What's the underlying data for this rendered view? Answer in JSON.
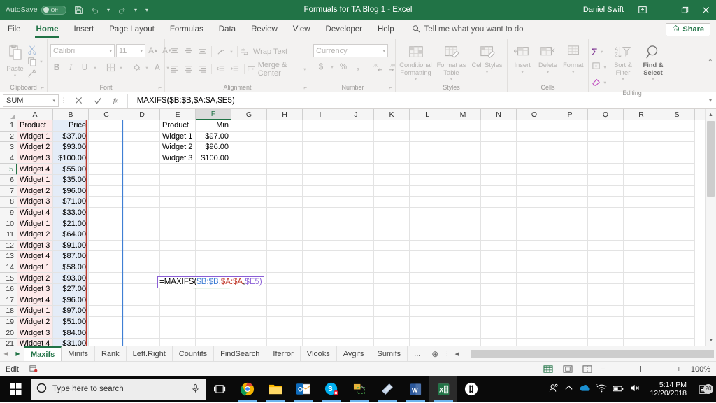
{
  "titlebar": {
    "autosave_label": "AutoSave",
    "autosave_state": "Off",
    "save_icon": "save-icon",
    "undo_icon": "undo-icon",
    "redo_icon": "redo-icon",
    "customize_icon": "customize-quick-access-icon",
    "document_title": "Formuals for TA Blog 1  -  Excel",
    "user_name": "Daniel Swift",
    "ribbon_display_icon": "ribbon-display-options-icon",
    "minimize_icon": "minimize-icon",
    "restore_icon": "restore-icon",
    "close_icon": "close-icon"
  },
  "ribbon_tabs": [
    {
      "label": "File",
      "active": false
    },
    {
      "label": "Home",
      "active": true
    },
    {
      "label": "Insert",
      "active": false
    },
    {
      "label": "Page Layout",
      "active": false
    },
    {
      "label": "Formulas",
      "active": false
    },
    {
      "label": "Data",
      "active": false
    },
    {
      "label": "Review",
      "active": false
    },
    {
      "label": "View",
      "active": false
    },
    {
      "label": "Developer",
      "active": false
    },
    {
      "label": "Help",
      "active": false
    }
  ],
  "tellme": {
    "icon": "search-icon",
    "placeholder": "Tell me what you want to do"
  },
  "share": {
    "label": "Share",
    "icon": "share-icon"
  },
  "ribbon": {
    "clipboard": {
      "group_label": "Clipboard",
      "paste_label": "Paste",
      "cut_label": "Cut",
      "copy_label": "Copy",
      "format_painter_label": "Format Painter"
    },
    "font": {
      "group_label": "Font",
      "font_name": "Calibri",
      "font_size": "11",
      "grow_font_label": "A",
      "shrink_font_label": "A",
      "bold_label": "B",
      "italic_label": "I",
      "underline_label": "U",
      "borders_label": "Borders",
      "fill_color_label": "Fill Color",
      "font_color_label": "A"
    },
    "alignment": {
      "group_label": "Alignment",
      "wrap_text_label": "Wrap Text",
      "merge_center_label": "Merge & Center"
    },
    "number": {
      "group_label": "Number",
      "format_value": "Currency",
      "accounting_label": "$",
      "percent_label": "%",
      "comma_label": ",",
      "increase_decimal_label": "Increase Decimal",
      "decrease_decimal_label": "Decrease Decimal"
    },
    "styles": {
      "group_label": "Styles",
      "conditional_formatting_label": "Conditional Formatting",
      "format_as_table_label": "Format as Table",
      "cell_styles_label": "Cell Styles"
    },
    "cells": {
      "group_label": "Cells",
      "insert_label": "Insert",
      "delete_label": "Delete",
      "format_label": "Format"
    },
    "editing": {
      "group_label": "Editing",
      "autosum_label": "AutoSum",
      "fill_label": "Fill",
      "clear_label": "Clear",
      "sort_filter_label": "Sort & Filter",
      "find_select_label": "Find & Select"
    },
    "collapse_icon": "collapse-ribbon-icon"
  },
  "formula_bar": {
    "name_box": "SUM",
    "cancel_icon": "cancel-icon",
    "enter_icon": "enter-icon",
    "insert_function_icon": "fx-icon",
    "formula": "=MAXIFS($B:$B,$A:$A,$E5)",
    "expand_icon": "expand-formula-bar-icon"
  },
  "grid": {
    "columns": [
      "A",
      "B",
      "C",
      "D",
      "E",
      "F",
      "G",
      "H",
      "I",
      "J",
      "K",
      "L",
      "M",
      "N",
      "O",
      "P",
      "Q",
      "R",
      "S"
    ],
    "selected_column": "F",
    "selected_row": 5,
    "rows": [
      1,
      2,
      3,
      4,
      5,
      6,
      7,
      8,
      9,
      10,
      11,
      12,
      13,
      14,
      15,
      16,
      17,
      18,
      19,
      20,
      21
    ],
    "data": {
      "A": [
        "Product",
        "Widget 1",
        "Widget 2",
        "Widget 3",
        "Widget 4",
        "Widget 1",
        "Widget 2",
        "Widget 3",
        "Widget 4",
        "Widget 1",
        "Widget 2",
        "Widget 3",
        "Widget 4",
        "Widget 1",
        "Widget 2",
        "Widget 3",
        "Widget 4",
        "Widget 1",
        "Widget 2",
        "Widget 3",
        "Widget 4"
      ],
      "B": [
        "Price",
        "$37.00",
        "$93.00",
        "$100.00",
        "$55.00",
        "$35.00",
        "$96.00",
        "$71.00",
        "$33.00",
        "$21.00",
        "$64.00",
        "$91.00",
        "$87.00",
        "$58.00",
        "$93.00",
        "$27.00",
        "$96.00",
        "$97.00",
        "$51.00",
        "$84.00",
        "$31.00"
      ],
      "E": [
        "Product",
        "Widget 1",
        "Widget 2",
        "Widget 3",
        "",
        "",
        "",
        "",
        "",
        "",
        "",
        "",
        "",
        "",
        "",
        "",
        "",
        "",
        "",
        "",
        ""
      ],
      "F": [
        "Min",
        "$97.00",
        "$96.00",
        "$100.00",
        "",
        "",
        "",
        "",
        "",
        "",
        "",
        "",
        "",
        "",
        "",
        "",
        "",
        "",
        "",
        "",
        ""
      ]
    },
    "editing_cell": {
      "address": "F5",
      "segments": [
        {
          "text": "=MAXIFS(",
          "color": "black"
        },
        {
          "text": "$B:$B",
          "color": "blue"
        },
        {
          "text": ",",
          "color": "black"
        },
        {
          "text": "$A:$A",
          "color": "red"
        },
        {
          "text": ",",
          "color": "black"
        },
        {
          "text": "$E5",
          "color": "purple"
        },
        {
          "text": ")",
          "color": "purple"
        }
      ]
    }
  },
  "sheet_tabs": {
    "first_icon": "first-sheet-icon",
    "prev_icon": "previous-sheet-icon",
    "tabs": [
      {
        "label": "Maxifs",
        "active": true
      },
      {
        "label": "Minifs",
        "active": false
      },
      {
        "label": "Rank",
        "active": false
      },
      {
        "label": "Left.Right",
        "active": false
      },
      {
        "label": "Countifs",
        "active": false
      },
      {
        "label": "FindSearch",
        "active": false
      },
      {
        "label": "Iferror",
        "active": false
      },
      {
        "label": "Vlooks",
        "active": false
      },
      {
        "label": "Avgifs",
        "active": false
      },
      {
        "label": "Sumifs",
        "active": false
      }
    ],
    "overflow_label": "...",
    "add_sheet_icon": "add-sheet-icon"
  },
  "status_bar": {
    "mode": "Edit",
    "recording_icon": "macro-record-icon",
    "normal_view_icon": "normal-view-icon",
    "page_layout_icon": "page-layout-view-icon",
    "page_break_icon": "page-break-preview-icon",
    "zoom_out_label": "−",
    "zoom_in_label": "+",
    "zoom_value": "100%"
  },
  "taskbar": {
    "start_icon": "windows-start-icon",
    "search_icon": "cortana-circle-icon",
    "search_placeholder": "Type here to search",
    "mic_icon": "microphone-icon",
    "taskview_icon": "task-view-icon",
    "apps": [
      {
        "name": "chrome-icon",
        "open": true
      },
      {
        "name": "file-explorer-icon",
        "open": true
      },
      {
        "name": "outlook-icon",
        "open": true
      },
      {
        "name": "skype-icon",
        "open": true
      },
      {
        "name": "snipping-tool-icon",
        "open": true
      },
      {
        "name": "sticky-notes-icon",
        "open": true
      },
      {
        "name": "word-icon",
        "open": true
      },
      {
        "name": "excel-icon",
        "open": true,
        "active": true
      },
      {
        "name": "slack-icon",
        "open": false
      }
    ],
    "tray": {
      "people_icon": "people-icon",
      "show_hidden_icon": "show-hidden-icons-icon",
      "onedrive_icon": "onedrive-icon",
      "network_icon": "wifi-icon",
      "battery_icon": "battery-icon",
      "volume_icon": "volume-muted-icon"
    },
    "clock_time": "5:14 PM",
    "clock_date": "12/20/2018",
    "notification_icon": "action-center-icon",
    "notification_count": "20"
  },
  "colors": {
    "excel_green": "#217346",
    "range_blue": "#3f7fd4",
    "range_red": "#c0392b",
    "range_purple": "#8b5fd6"
  }
}
